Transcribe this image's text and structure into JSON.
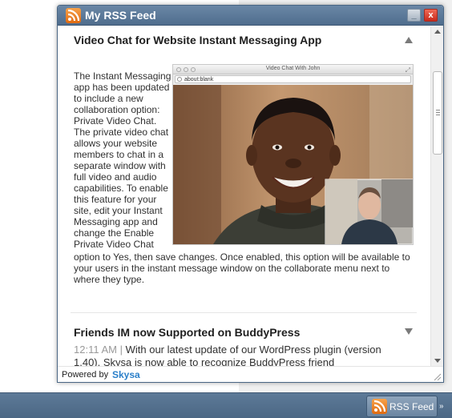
{
  "popup": {
    "title": "My RSS Feed",
    "minimize_label": "_",
    "close_label": "x"
  },
  "items": [
    {
      "title": "Video Chat for Website Instant Messaging App",
      "text_lines": [
        "The Instant Messaging",
        "app has been updated",
        "to include a new",
        "collaboration option:",
        "Private Video Chat.",
        "The private video chat",
        "allows your website",
        "members to chat in a",
        "separate window with",
        "full video and audio",
        "capabilities. To enable",
        "this feature for your",
        "site, edit your Instant",
        "Messaging app and",
        "change the Enable",
        "Private Video Chat"
      ],
      "text_full_lines": [
        "option to Yes, then save changes. Once enabled, this option will be available to",
        "your users in the instant message window on the collaborate menu next to",
        "where they type."
      ],
      "screenshot": {
        "window_title": "Video Chat With John",
        "url": "about:blank"
      }
    },
    {
      "title": "Friends IM now Supported on BuddyPress",
      "timestamp": "12:11 AM",
      "separator": "|",
      "text_first": "With our latest update of our WordPress plugin (version",
      "text_second": "1.40), Skysa is now able to recognize BuddyPress friend"
    }
  ],
  "footer": {
    "powered_by": "Powered by",
    "brand": "Skysa"
  },
  "taskbar": {
    "rss_tab_label": "RSS Feed",
    "arrows": "»"
  },
  "colors": {
    "titlebar": "#5a7797",
    "brand": "#2a7fc9",
    "rss_orange": "#f08a24",
    "timestamp": "#999999"
  }
}
